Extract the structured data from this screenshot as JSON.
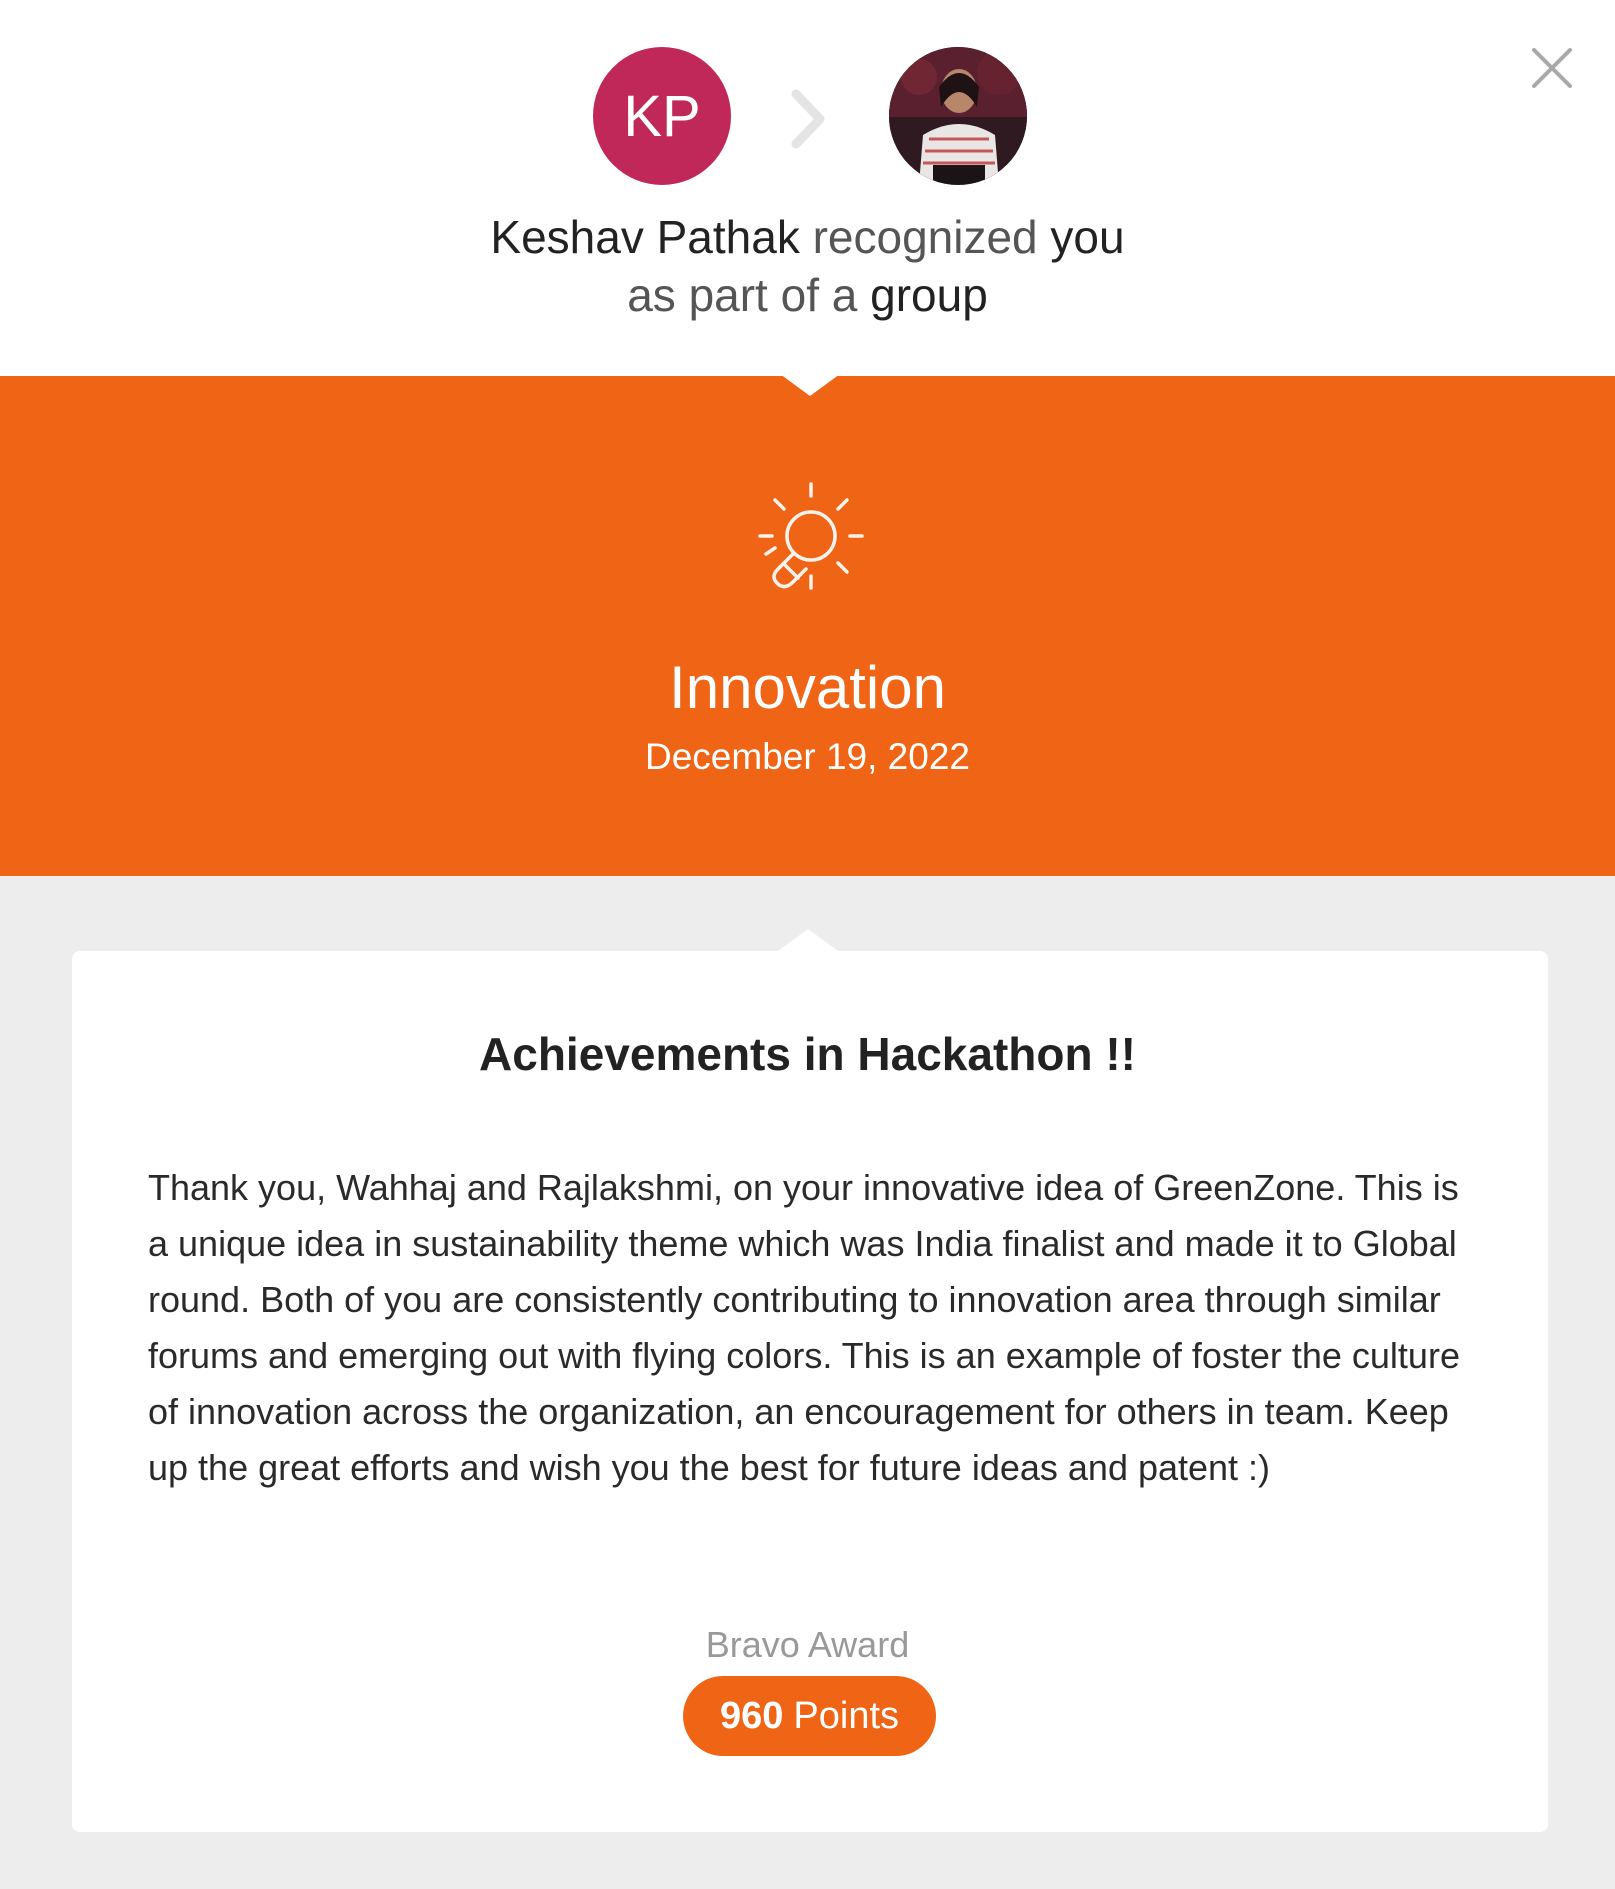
{
  "recognition": {
    "giver_initials": "KP",
    "giver_name": "Keshav Pathak",
    "verb": "recognized",
    "recipient": "you",
    "line2_prefix": "as part of a",
    "line2_group": "group"
  },
  "value": {
    "icon": "lightbulb-icon",
    "title": "Innovation",
    "date": "December 19, 2022"
  },
  "card": {
    "title": "Achievements in Hackathon !!",
    "message": "Thank you, Wahhaj and Rajlakshmi, on your innovative idea of GreenZone. This is a unique idea in sustainability theme which was India finalist and made it to Global round. Both of you are consistently contributing to innovation area through similar forums and emerging out with flying colors. This is an example of foster the culture of innovation across the organization, an encouragement for others in team. Keep up the great efforts and wish you the best for future ideas and patent :)",
    "award_label": "Bravo Award",
    "points_value": "960",
    "points_unit": "Points"
  },
  "colors": {
    "accent": "#ef6415",
    "avatar_bg": "#c0285a",
    "background": "#ededed"
  },
  "icons": [
    "close-icon",
    "chevron-right-icon",
    "lightbulb-icon"
  ]
}
